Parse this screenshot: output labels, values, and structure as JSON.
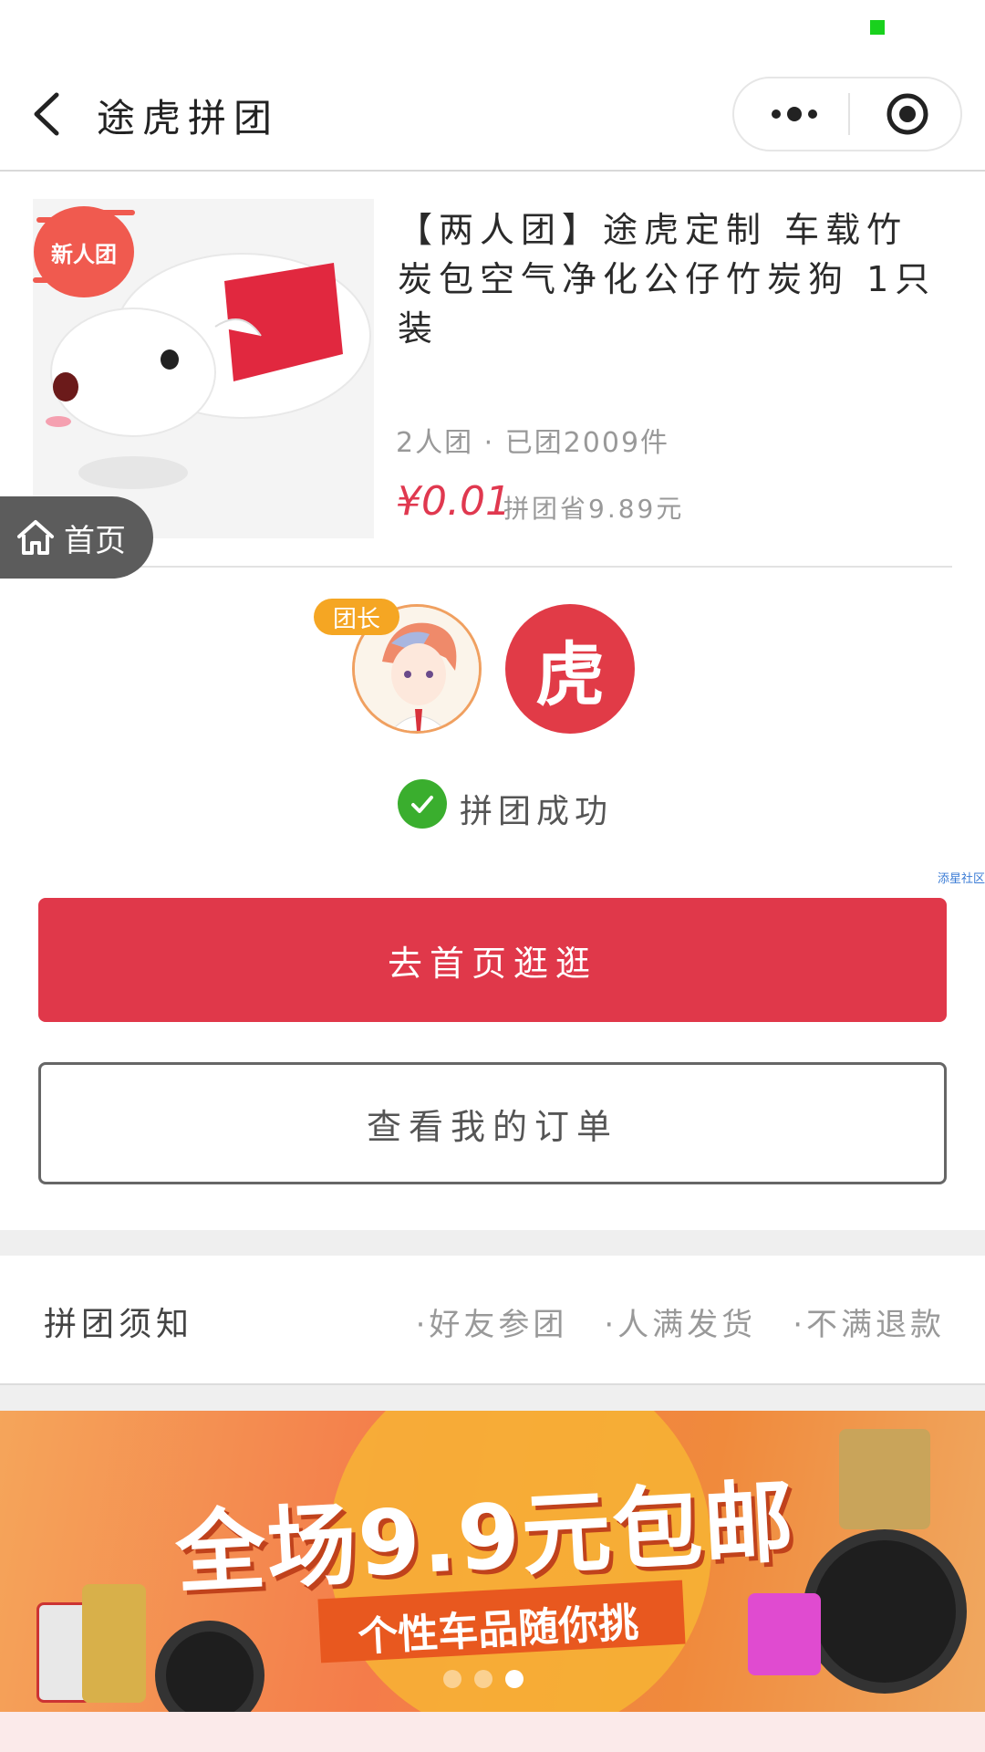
{
  "status": {
    "indicator_color": "#19d11d"
  },
  "navbar": {
    "title": "途虎拼团",
    "back_icon": "chevron-left-icon",
    "more_icon": "more-dots-icon",
    "close_icon": "target-close-icon"
  },
  "product": {
    "badge": "新人团",
    "title": "【两人团】途虎定制 车载竹炭包空气净化公仔竹炭狗 1只装",
    "meta": "2人团 · 已团2009件",
    "price": "¥0.01",
    "save": "拼团省9.89元"
  },
  "home_float": {
    "label": "首页",
    "icon": "home-icon"
  },
  "group": {
    "leader_tag": "团长",
    "logo_text": "虎",
    "success_text": "拼团成功"
  },
  "tiny_link": "添星社区",
  "buttons": {
    "primary": "去首页逛逛",
    "secondary": "查看我的订单"
  },
  "rules": {
    "title": "拼团须知",
    "items": [
      "·好友参团",
      "·人满发货",
      "·不满退款"
    ]
  },
  "banner": {
    "headline": "全场9.9元包邮",
    "sub": "个性车品随你挑",
    "dots": 3,
    "active_dot": 3
  },
  "colors": {
    "accent": "#e0384a",
    "leader": "#f5a623",
    "success": "#3aae2e"
  }
}
